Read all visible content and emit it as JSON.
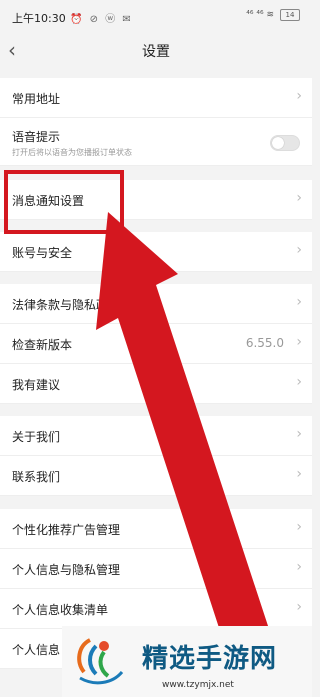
{
  "status_bar": {
    "time": "上午10:30",
    "indicators": "⏰ ⊘ ⓦ ✉",
    "signal": "⁴⁶ ⁴⁶ ≋",
    "battery": "14"
  },
  "header": {
    "title": "设置",
    "back_icon": "back-chevron-icon"
  },
  "settings": [
    {
      "label": "常用地址",
      "type": "link"
    },
    {
      "label": "语音提示",
      "type": "toggle",
      "sublabel": "打开后将以语音为您播报订单状态",
      "enabled": false
    },
    {
      "label": "消息通知设置",
      "type": "link"
    },
    {
      "label": "账号与安全",
      "type": "link"
    },
    {
      "label": "法律条款与隐私政策",
      "type": "link"
    },
    {
      "label": "检查新版本",
      "type": "value",
      "value": "6.55.0"
    },
    {
      "label": "我有建议",
      "type": "link"
    },
    {
      "label": "关于我们",
      "type": "link"
    },
    {
      "label": "联系我们",
      "type": "link"
    },
    {
      "label": "个性化推荐广告管理",
      "type": "link"
    },
    {
      "label": "个人信息与隐私管理",
      "type": "link"
    },
    {
      "label": "个人信息收集清单",
      "type": "link"
    },
    {
      "label": "个人信息",
      "type": "link"
    }
  ],
  "annotation": {
    "color": "#d4171f"
  },
  "watermark": {
    "brand_text": "精选手游网",
    "url": "www.tzymjx.net"
  }
}
